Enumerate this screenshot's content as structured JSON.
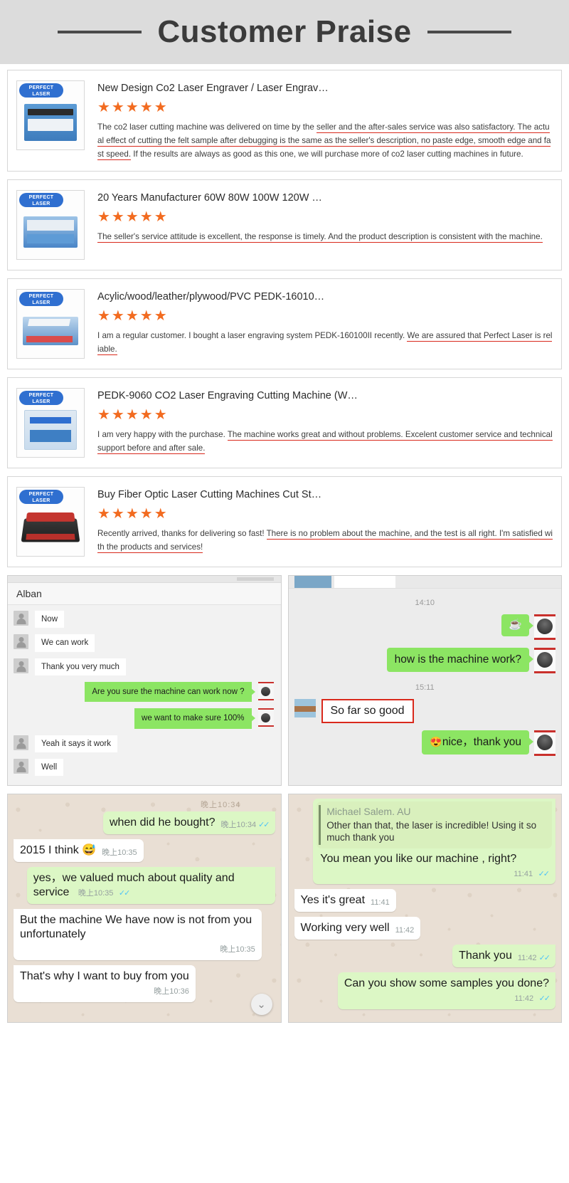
{
  "header": {
    "title": "Customer Praise"
  },
  "reviews": [
    {
      "brand": "PERFECT LASER",
      "title": "New Design Co2 Laser Engraver / Laser Engrav…",
      "stars": "★★★★★",
      "text_parts": [
        {
          "t": "The co2 laser cutting machine was delivered on time by the ",
          "u": false
        },
        {
          "t": "seller and the after-sales service was also satisfactory. The actual effect of cutting the felt sample after debugging is the same as the seller's description, no paste edge, smooth edge and fast speed.",
          "u": true
        },
        {
          "t": " If the results are always as good as this one, we will purchase more of co2 laser cutting machines in future.",
          "u": false
        }
      ]
    },
    {
      "brand": "PERFECT LASER",
      "title": "20 Years Manufacturer 60W 80W 100W 120W …",
      "stars": "★★★★★",
      "text_parts": [
        {
          "t": "The seller's service attitude is excellent, the response is timely. And the product description is consistent with the machine.",
          "u": true
        }
      ]
    },
    {
      "brand": "PERFECT LASER",
      "title": "Acylic/wood/leather/plywood/PVC PEDK-16010…",
      "stars": "★★★★★",
      "text_parts": [
        {
          "t": "I am a regular customer. I bought a laser engraving system PEDK-160100II recently. ",
          "u": false
        },
        {
          "t": "We are assured that Perfect Laser is reliable.",
          "u": true
        }
      ]
    },
    {
      "brand": "PERFECT LASER",
      "title": "PEDK-9060 CO2 Laser Engraving Cutting Machine (W…",
      "stars": "★★★★★",
      "text_parts": [
        {
          "t": "I am very happy with the purchase. ",
          "u": false
        },
        {
          "t": "The machine works great and without problems. Excelent customer service and technical support before and after sale.",
          "u": true
        }
      ]
    },
    {
      "brand": "PERFECT LASER",
      "title": "Buy Fiber Optic Laser Cutting Machines Cut St…",
      "stars": "★★★★★",
      "text_parts": [
        {
          "t": "Recently arrived, thanks for delivering so fast! ",
          "u": false
        },
        {
          "t": "There is no problem about the machine, and the test is all right. I'm satisfied with the products and services!",
          "u": true
        }
      ]
    }
  ],
  "chat_alibaba": {
    "contact_name": "Alban",
    "messages": [
      {
        "side": "in",
        "text": "Now"
      },
      {
        "side": "in",
        "text": "We can work"
      },
      {
        "side": "in",
        "text": "Thank you very much"
      },
      {
        "side": "out",
        "text": "Are you sure the machine can work now ?"
      },
      {
        "side": "out",
        "text": "we want to make sure 100%"
      },
      {
        "side": "in",
        "text": "Yeah it says it work"
      },
      {
        "side": "in",
        "text": "Well"
      }
    ]
  },
  "chat_wechat": {
    "timestamps": {
      "first": "14:10",
      "second": "15:11"
    },
    "messages": [
      {
        "side": "out",
        "text": "☕",
        "kind": "emoji"
      },
      {
        "side": "out",
        "text": "how is the machine work?",
        "kind": "text"
      },
      {
        "side": "in",
        "text": "So far so good",
        "kind": "highlight"
      },
      {
        "side": "out",
        "text": "nice，thank you",
        "emoji": "😍",
        "kind": "emoji-text"
      }
    ]
  },
  "chat_whatsapp_left": {
    "partial_timestamp": "晚上10:34",
    "messages": [
      {
        "side": "out",
        "text": "when did he bought?",
        "time": "晚上10:34",
        "ticks": "✓✓"
      },
      {
        "side": "in",
        "text": "2015 I think 😅",
        "time": "晚上10:35",
        "ticks": ""
      },
      {
        "side": "out",
        "text": "yes，we valued much about quality and service",
        "time": "晚上10:35",
        "ticks": "✓✓"
      },
      {
        "side": "in",
        "text": "But the machine We have now is not from you unfortunately",
        "time": "晚上10:35",
        "ticks": ""
      },
      {
        "side": "in",
        "text": "That's why I want to buy from you",
        "time": "晚上10:36",
        "ticks": ""
      }
    ],
    "scroll_button": "⌄"
  },
  "chat_whatsapp_right": {
    "quote": {
      "name": "Michael Salem. AU",
      "text": "Other than that, the laser is incredible! Using it so much thank you"
    },
    "messages": [
      {
        "side": "out",
        "text": "You mean you like our machine , right?",
        "time": "11:41",
        "ticks": "✓✓"
      },
      {
        "side": "in",
        "text": "Yes it's great",
        "time": "11:41",
        "ticks": ""
      },
      {
        "side": "in",
        "text": "Working very well",
        "time": "11:42",
        "ticks": ""
      },
      {
        "side": "out",
        "text": "Thank you",
        "time": "11:42",
        "ticks": "✓✓"
      },
      {
        "side": "out",
        "text": "Can you show some samples you done?",
        "time": "11:42",
        "ticks": "✓✓"
      }
    ]
  },
  "colors": {
    "header_bg": "#dcdcdc",
    "star": "#f26b20",
    "underline": "#d9291c",
    "bubble_out": "#8ce563",
    "wa_out": "#dcf7c5",
    "brand_blue": "#2f6fd0"
  }
}
